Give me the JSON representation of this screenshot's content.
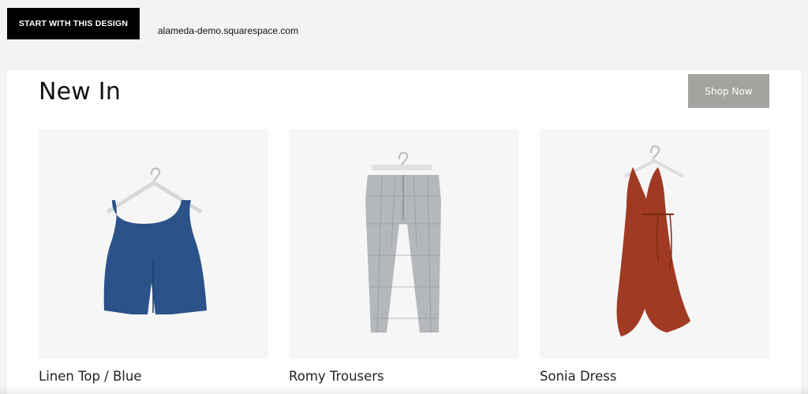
{
  "topbar": {
    "start_button_label": "START WITH THIS DESIGN",
    "domain": "alameda-demo.squarespace.com"
  },
  "section": {
    "title": "New In",
    "shop_button_label": "Shop Now"
  },
  "products": [
    {
      "name": "Linen Top / Blue",
      "image": "blue-linen-top",
      "color": "#2b5289"
    },
    {
      "name": "Romy Trousers",
      "image": "grey-check-trousers",
      "color": "#b4b7bb"
    },
    {
      "name": "Sonia Dress",
      "image": "rust-dress",
      "color": "#a03a22"
    }
  ]
}
